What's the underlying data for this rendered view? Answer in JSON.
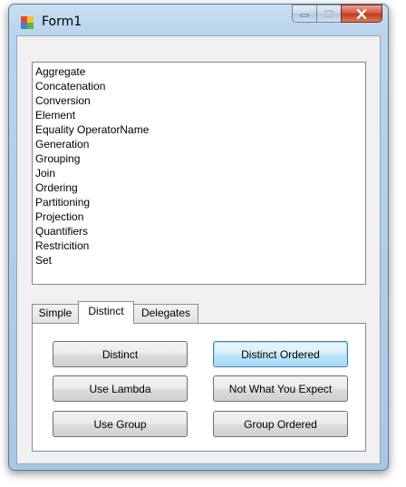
{
  "window": {
    "title": "Form1",
    "icons": {
      "app": "form-icon",
      "minimize": "minimize-icon",
      "maximize": "maximize-icon",
      "close": "close-icon"
    }
  },
  "listbox": {
    "items": [
      "Aggregate",
      "Concatenation",
      "Conversion",
      "Element",
      "Equality OperatorName",
      "Generation",
      "Grouping",
      "Join",
      "Ordering",
      "Partitioning",
      "Projection",
      "Quantifiers",
      "Restricition",
      "Set"
    ]
  },
  "tabs": [
    {
      "label": "Simple",
      "selected": false
    },
    {
      "label": "Distinct",
      "selected": true
    },
    {
      "label": "Delegates",
      "selected": false
    }
  ],
  "buttons": {
    "distinct": "Distinct",
    "distinct_ordered": "Distinct Ordered",
    "use_lambda": "Use Lambda",
    "not_what_you_expect": "Not What You Expect",
    "use_group": "Use Group",
    "group_ordered": "Group Ordered"
  }
}
